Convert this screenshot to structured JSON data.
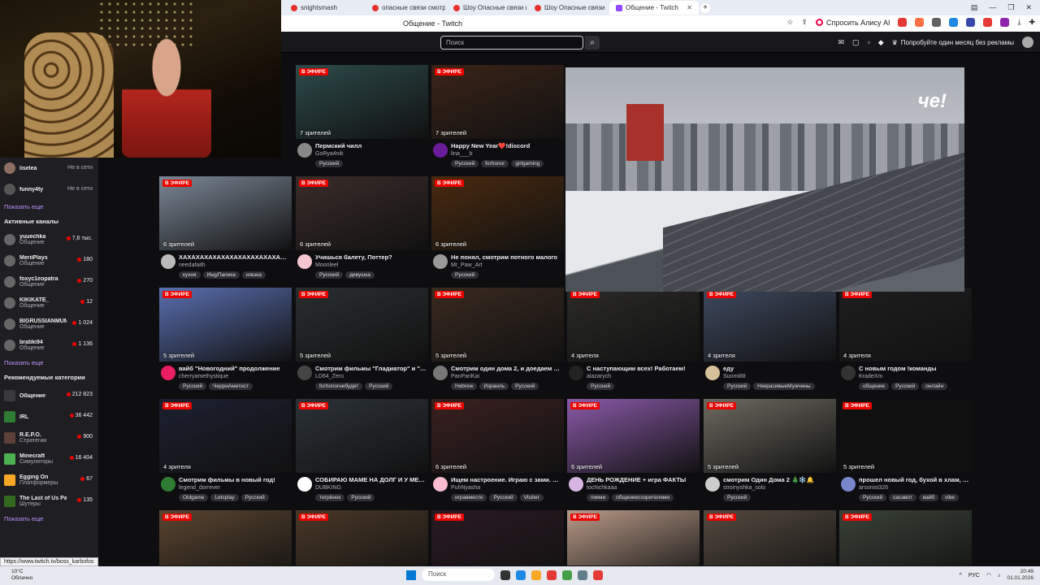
{
  "browser": {
    "tabs": [
      {
        "label": "snightsmash",
        "active": false
      },
      {
        "label": "опасные связи смотреть",
        "active": false
      },
      {
        "label": "Шоу Опасные связи (18+",
        "active": false
      },
      {
        "label": "Шоу Опасные связи",
        "active": false
      },
      {
        "label": "Общение - Twitch",
        "active": true
      }
    ],
    "page_title": "Общение - Twitch",
    "ask_alice": "Спросить Алису AI"
  },
  "twitch": {
    "search_placeholder": "Поиск",
    "prime_offer": "Попробуйте один месяц без рекламы",
    "live_badge": "В ЭФИРЕ"
  },
  "sidebar": {
    "followed": [
      {
        "name": "liselea",
        "status": "Не в сети"
      },
      {
        "name": "funny4ty",
        "status": "Не в сети"
      }
    ],
    "show_more_1": "Показать еще",
    "active_header": "Активные каналы",
    "active": [
      {
        "name": "yuuechka",
        "game": "Общение",
        "viewers": "7,6 тыс."
      },
      {
        "name": "MeriiPlays",
        "game": "Общение",
        "viewers": "180"
      },
      {
        "name": "foxyc1eopatra",
        "game": "Общение",
        "viewers": "270"
      },
      {
        "name": "KIKIKATE_",
        "game": "Общение",
        "viewers": "12"
      },
      {
        "name": "BIGRUSSIANMUM",
        "game": "Общение",
        "viewers": "1 024"
      },
      {
        "name": "bratiki94",
        "game": "Общение",
        "viewers": "1 136"
      }
    ],
    "show_more_2": "Показать еще",
    "categories_header": "Рекомендуемые категории",
    "categories": [
      {
        "name": "Общение",
        "sub": "",
        "viewers": "212 823",
        "color": "#3a3a3d"
      },
      {
        "name": "IRL",
        "sub": "",
        "viewers": "36 442",
        "color": "#2e7d32"
      },
      {
        "name": "R.E.P.O.",
        "sub": "Стратегии",
        "viewers": "900",
        "color": "#5d4037"
      },
      {
        "name": "Minecraft",
        "sub": "Симуляторы",
        "viewers": "16 404",
        "color": "#4caf50"
      },
      {
        "name": "Egging On",
        "sub": "Платформеры",
        "viewers": "67",
        "color": "#f9a825"
      },
      {
        "name": "The Last of Us Pa...",
        "sub": "Шутеры",
        "viewers": "135",
        "color": "#33691e"
      }
    ],
    "show_more_3": "Показать еще"
  },
  "streams": [
    {
      "viewers": "7 зрителей",
      "title": "Пермский чилл",
      "channel": "GoRya4nik",
      "tags": [
        "Русский"
      ],
      "thumb": "#2d4a4a",
      "avatar": "#888"
    },
    {
      "viewers": "7 зрителей",
      "title": "Happy New Year❤️!discord",
      "channel": "lina___b",
      "tags": [
        "Русский",
        "forhonor",
        "girlgaming"
      ],
      "thumb": "#3b2418",
      "avatar": "#6a1b9a"
    },
    {
      "viewers": "6 зрителей",
      "title": "ХАХАХАХАХАХАХАХАХАХАХАХАХАХА...",
      "channel": "needafaith",
      "tags": [
        "кухня",
        "ИщуПапика",
        "няшка"
      ],
      "thumb": "#7b8796",
      "avatar": "#bbb"
    },
    {
      "viewers": "6 зрителей",
      "title": "Учишься балету, Поттер?",
      "channel": "Moonleel",
      "tags": [
        "Русский",
        "девушка"
      ],
      "thumb": "#3a2c2a",
      "avatar": "#f5c6d0"
    },
    {
      "viewers": "6 зрителей",
      "title": "Не понял, смотрим потного малого",
      "channel": "Mr_Paw_Art",
      "tags": [
        "Русский"
      ],
      "thumb": "#4a2a10",
      "avatar": "#999"
    },
    {
      "viewers": "5 зрителей",
      "title": "вайб \"Новогодний\" продолжение",
      "channel": "cherryamethystique",
      "tags": [
        "Русский",
        "ЧерриАметист"
      ],
      "thumb": "#5a6fb0",
      "avatar": "#e91e63"
    },
    {
      "viewers": "5 зрителей",
      "title": "Смотрим фильмы \"Гладиатор\" и \"Брюс...",
      "channel": "LD64_Zero",
      "tags": [
        "forhonorнебудет",
        "Русский"
      ],
      "thumb": "#2a2e30",
      "avatar": "#444"
    },
    {
      "viewers": "5 зрителей",
      "title": "Смотрим один дома 2, и доедаем сал...",
      "channel": "PanPariKai",
      "tags": [
        "Hebrew",
        "Израиль",
        "Русский"
      ],
      "thumb": "#3a2a20",
      "avatar": "#777"
    },
    {
      "viewers": "4 зрителя",
      "title": "С наступающим всех! Работаем!",
      "channel": "alazarych",
      "tags": [
        "Русский"
      ],
      "thumb": "#2b2a28",
      "avatar": "#222"
    },
    {
      "viewers": "4 зрителя",
      "title": "еду",
      "channel": "Suomi88",
      "tags": [
        "Русский",
        "НекрасивыеМужчины"
      ],
      "thumb": "#3f4a60",
      "avatar": "#d7c19a"
    },
    {
      "viewers": "4 зрителя",
      "title": "С новым годом !команды",
      "channel": "KradeXm",
      "tags": [
        "общение",
        "Русский",
        "онлайн"
      ],
      "thumb": "#1e1e20",
      "avatar": "#333"
    },
    {
      "viewers": "4 зрителя",
      "title": "Смотрим фильмы в новый год!",
      "channel": "legend_dorrever",
      "tags": [
        "Oldgame",
        "Letsplay",
        "Русский"
      ],
      "thumb": "#1c2030",
      "avatar": "#2e7d32"
    },
    {
      "viewers": "",
      "title": "СОБИРАЮ МАМЕ НА ДОЛГ И У МЕНЯ ...",
      "channel": "DUBKING",
      "tags": [
        "тигрёнок",
        "Русский"
      ],
      "thumb": "#2c3238",
      "avatar": "#fff"
    },
    {
      "viewers": "6 зрителей",
      "title": "Ищем настроение. Играю с зами. Роз...",
      "channel": "PuhNyasha",
      "tags": [
        "игравместе",
        "Русский",
        "Vtuber"
      ],
      "thumb": "#3a2020",
      "avatar": "#f8bbd0"
    },
    {
      "viewers": "6 зрителей",
      "title": "ДЕНЬ РОЖДЕНИЕ + игра ФАКТЫ",
      "channel": "tochichkaaa",
      "tags": [
        "пикми",
        "общениесозрителями"
      ],
      "thumb": "#8a5aa8",
      "avatar": "#d8b4e2"
    },
    {
      "viewers": "5 зрителей",
      "title": "смотрим Один Дома 2 🎄❄️🔔",
      "channel": "stroinyshka_solo",
      "tags": [
        "Русский"
      ],
      "thumb": "#6c6a60",
      "avatar": "#ccc"
    },
    {
      "viewers": "5 зрителей",
      "title": "прошел новый год, бухой в хлам, при...",
      "channel": "arsonist326",
      "tags": [
        "Русский",
        "сасавот",
        "вайб",
        "vibe"
      ],
      "thumb": "#101010",
      "avatar": "#7986cb"
    }
  ],
  "row5_thumbs": [
    "#5a4530",
    "#4a3828",
    "#2a1a22",
    "#b89a88",
    "#554a40",
    "#3a4238"
  ],
  "player": {
    "logo": "че!"
  },
  "status_url": "https://www.twitch.tv/boss_karbofos",
  "taskbar": {
    "temp": "10°C",
    "weather": "Облачно",
    "search": "Поиск",
    "lang": "РУС",
    "time": "20:49",
    "date": "01.01.2026"
  }
}
